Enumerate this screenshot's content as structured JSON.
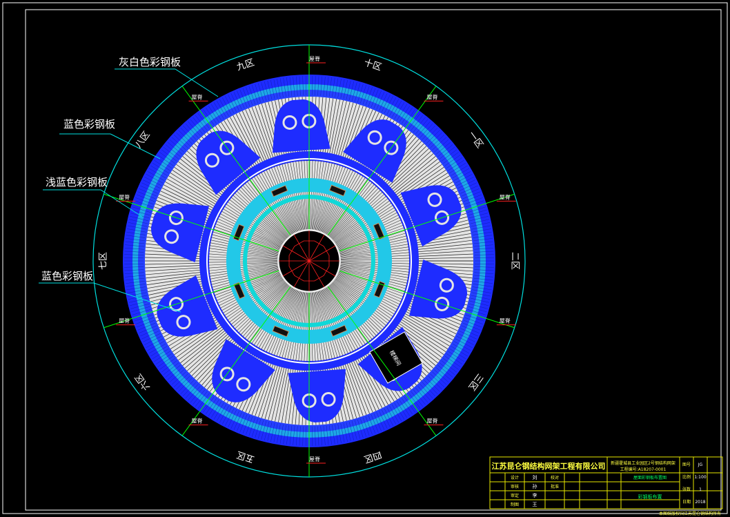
{
  "colors": {
    "background": "#000000",
    "frame": "#ffffff",
    "outer_ring": "#00e0e0",
    "zone_divider": "#00ff00",
    "blue_sheet": "#1e2cff",
    "light_blue_sheet": "#22c8e8",
    "grey_white_sheet": "#d8d8d8",
    "center": "#000000",
    "center_lines": "#ff2020",
    "title_block": "#e8e800",
    "leader": "#00e0e0"
  },
  "callouts": [
    {
      "text": "灰白色彩钢板"
    },
    {
      "text": "蓝色彩钢板"
    },
    {
      "text": "浅蓝色彩钢板"
    },
    {
      "text": "蓝色彩钢板"
    }
  ],
  "zones": [
    "九区",
    "十区",
    "一区",
    "二区",
    "三区",
    "四区",
    "五区",
    "六区",
    "七区",
    "八区"
  ],
  "ridge_label": "屋脊",
  "stair_label": "楼梯间",
  "title_block": {
    "company": "江苏昆仑钢结构网架工程有限公司",
    "project_line1": "新疆霍城县工业园区2号钢结构网架",
    "project_line2": "工程编号:A18207-0001",
    "drawing_title": "屋面彩钢板布置图",
    "drawing_subtitle": "彩钢板布置",
    "row_labels": [
      "设计",
      "审核",
      "审定",
      "制图",
      "校对",
      "批准"
    ],
    "signatures": [
      "刘",
      "孙",
      "李",
      "王"
    ],
    "right_labels": [
      "图号",
      "比例",
      "张数",
      "日期"
    ],
    "right_values": [
      "JG",
      "1:100",
      "1",
      "2018"
    ],
    "footnote": "本图纸版权归江苏昆仑钢结构所有"
  }
}
